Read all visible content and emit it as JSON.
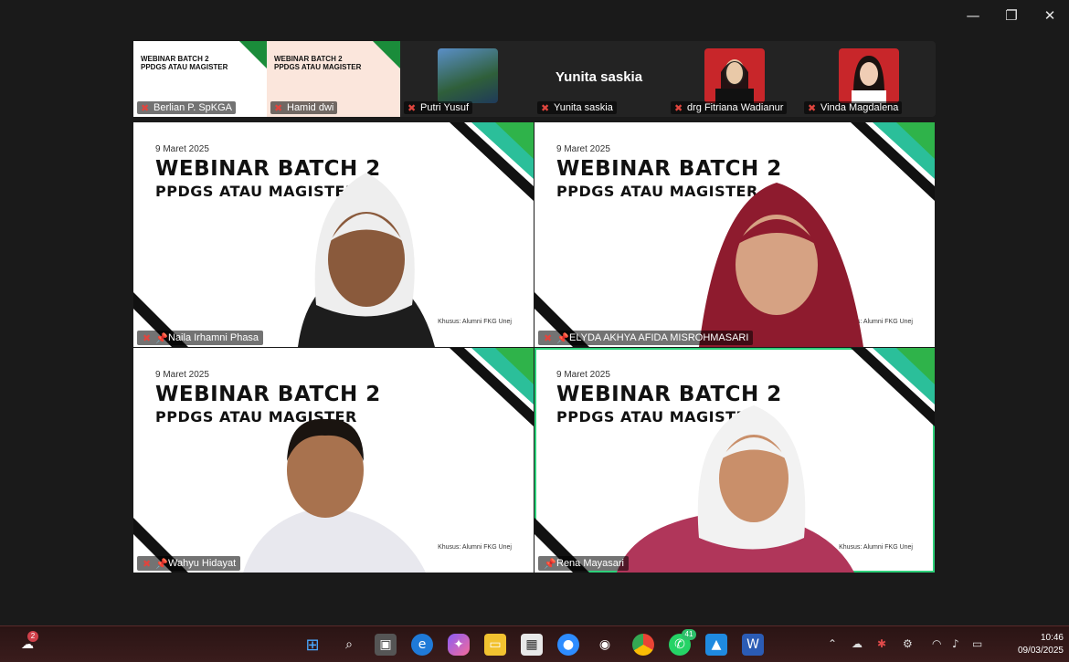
{
  "window": {
    "controls": [
      "—",
      "❐",
      "✕"
    ]
  },
  "strip": {
    "thumbs": [
      {
        "name": "Berlian P. SpKGA",
        "title1": "WEBINAR BATCH 2",
        "title2": "PPDGS ATAU MAGISTER"
      },
      {
        "name": "Hamid dwi",
        "title1": "WEBINAR BATCH 2",
        "title2": "PPDGS ATAU MAGISTER"
      },
      {
        "name": "Putri Yusuf"
      },
      {
        "name": "Yunita saskia",
        "big": "Yunita saskia"
      },
      {
        "name": "drg Fitriana Wadianur"
      },
      {
        "name": "Vinda Magdalena"
      }
    ]
  },
  "tiles": [
    {
      "date": "9 Maret 2025",
      "title1": "WEBINAR BATCH 2",
      "title2": "PPDGS ATAU MAGISTER",
      "footer": "Khusus: Alumni FKG Unej",
      "name": "Naila Irhamni Phasa"
    },
    {
      "date": "9 Maret 2025",
      "title1": "WEBINAR BATCH 2",
      "title2": "PPDGS ATAU MAGISTER",
      "footer": "Khusus: Alumni FKG Unej",
      "name": "ELYDA AKHYA AFIDA MISROHMASARI"
    },
    {
      "date": "9 Maret 2025",
      "title1": "WEBINAR BATCH 2",
      "title2": "PPDGS ATAU MAGISTER",
      "footer": "Khusus: Alumni FKG Unej",
      "name": "Wahyu Hidayat"
    },
    {
      "date": "9 Maret 2025",
      "title1": "WEBINAR BATCH 2",
      "title2": "PPDGS ATAU MAGISTER",
      "footer": "Khusus: Alumni FKG Unej",
      "name": "Rena Mayasari"
    }
  ],
  "taskbar": {
    "weather_badge": "2",
    "whatsapp_badge": "41",
    "time": "10:46",
    "date": "09/03/2025"
  },
  "colors": {
    "accent_green": "#1a8c3a",
    "teal": "#2bbf9a",
    "active_border": "#2ed07a"
  }
}
